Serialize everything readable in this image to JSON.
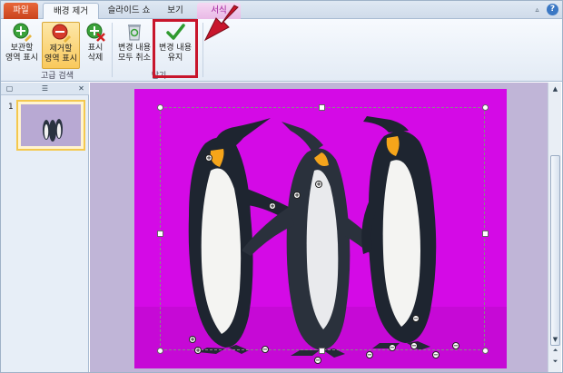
{
  "ribbon_tabs": {
    "file": "파일",
    "background_removal": "배경 제거",
    "slideshow": "슬라이드 쇼",
    "view": "보기",
    "format": "서식"
  },
  "help_label": "?",
  "ribbon": {
    "mark_keep_line1": "보관할",
    "mark_keep_line2": "영역 표시",
    "mark_remove_line1": "제거할",
    "mark_remove_line2": "영역 표시",
    "delete_mark_line1": "표시",
    "delete_mark_line2": "삭제",
    "group_refine": "고급 검색",
    "discard_line1": "변경 내용",
    "discard_line2": "모두 취소",
    "keep_changes_line1": "변경 내용",
    "keep_changes_line2": "유지",
    "group_close": "닫기"
  },
  "slides_panel": {
    "slide_number": "1"
  },
  "colors": {
    "removed_area": "#d40ae6",
    "highlight_box": "#c8162c"
  }
}
